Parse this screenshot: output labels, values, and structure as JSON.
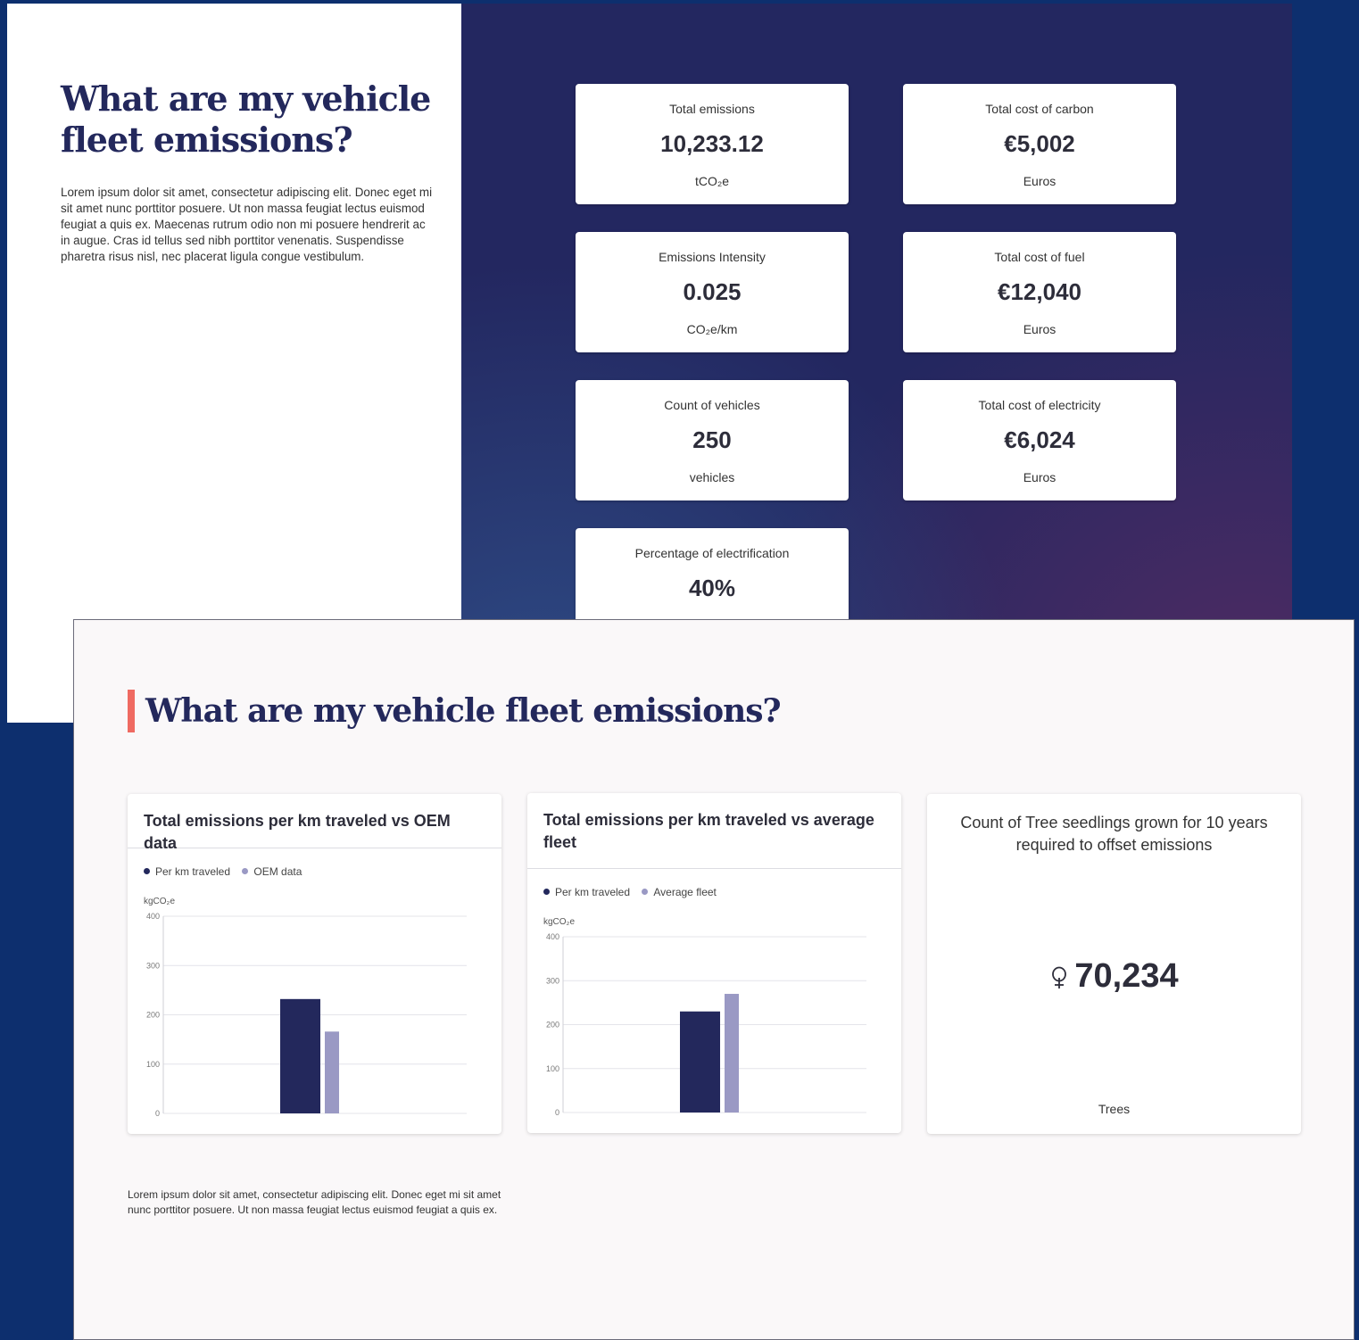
{
  "back_slide": {
    "title": "What are my vehicle fleet emissions?",
    "body": "Lorem ipsum dolor sit amet, consectetur adipiscing elit. Donec eget mi sit amet nunc porttitor posuere. Ut non massa feugiat lectus euismod feugiat a quis ex. Maecenas rutrum odio non mi posuere hendrerit ac in augue. Cras id tellus sed nibh porttitor venenatis. Suspendisse pharetra risus nisl, nec placerat ligula congue vestibulum.",
    "kpis": [
      {
        "label": "Total emissions",
        "value": "10,233.12",
        "unit": "tCO₂e"
      },
      {
        "label": "Total cost of carbon",
        "value": "€5,002",
        "unit": "Euros"
      },
      {
        "label": "Emissions Intensity",
        "value": "0.025",
        "unit": "CO₂e/km"
      },
      {
        "label": "Total cost of fuel",
        "value": "€12,040",
        "unit": "Euros"
      },
      {
        "label": "Count of vehicles",
        "value": "250",
        "unit": "vehicles"
      },
      {
        "label": "Total cost of electricity",
        "value": "€6,024",
        "unit": "Euros"
      },
      {
        "label": "Percentage of electrification",
        "value": "40%",
        "unit": ""
      }
    ]
  },
  "front_slide": {
    "title": "What are my vehicle fleet emissions?",
    "accent_color": "#ef6a62",
    "footer": "Lorem ipsum dolor sit amet, consectetur adipiscing elit. Donec eget mi sit amet nunc porttitor posuere. Ut non massa feugiat lectus euismod feugiat a quis ex.",
    "tree_card": {
      "title": "Count of Tree seedlings grown for 10 years required to offset emissions",
      "icon": "tree-icon",
      "value": "70,234",
      "unit": "Trees"
    }
  },
  "colors": {
    "primary": "#23285c",
    "secondary": "#9a99c4",
    "accent": "#ef6a62"
  },
  "chart_data": [
    {
      "type": "bar",
      "title": "Total emissions per km traveled vs OEM data",
      "ylabel": "kgCO₂e",
      "ylim": [
        0,
        400
      ],
      "yticks": [
        0,
        100,
        200,
        300,
        400
      ],
      "categories": [
        ""
      ],
      "grid": true,
      "legend_position": "top-left",
      "series": [
        {
          "name": "Per km traveled",
          "color": "#23285c",
          "values": [
            232
          ]
        },
        {
          "name": "OEM data",
          "color": "#9a99c4",
          "values": [
            166
          ]
        }
      ]
    },
    {
      "type": "bar",
      "title": "Total emissions per km traveled vs average fleet",
      "ylabel": "kgCO₂e",
      "ylim": [
        0,
        400
      ],
      "yticks": [
        0,
        100,
        200,
        300,
        400
      ],
      "categories": [
        ""
      ],
      "grid": true,
      "legend_position": "top-left",
      "series": [
        {
          "name": "Per km traveled",
          "color": "#23285c",
          "values": [
            230
          ]
        },
        {
          "name": "Average fleet",
          "color": "#9a99c4",
          "values": [
            270
          ]
        }
      ]
    }
  ]
}
